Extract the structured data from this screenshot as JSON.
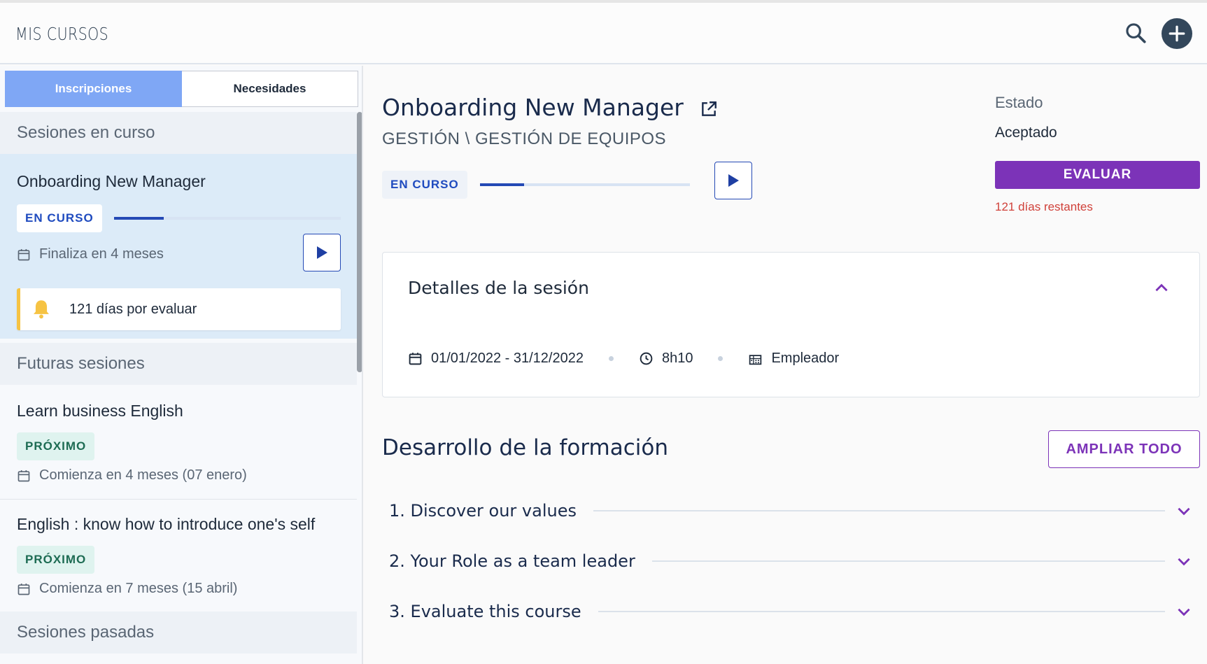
{
  "header": {
    "title": "MIS CURSOS"
  },
  "tabs": {
    "active": "Inscripciones",
    "inactive": "Necesidades"
  },
  "sections": {
    "current": "Sesiones en curso",
    "future": "Futuras sesiones",
    "past": "Sesiones pasadas"
  },
  "current_courses": [
    {
      "title": "Onboarding New Manager",
      "badge": "EN CURSO",
      "progress": 0.22,
      "meta": "Finaliza en 4 meses",
      "alert": "121 días por evaluar"
    }
  ],
  "future_courses": [
    {
      "title": "Learn business English",
      "badge": "PRÓXIMO",
      "meta": "Comienza en 4 meses (07 enero)"
    },
    {
      "title": "English : know how to introduce one's self",
      "badge": "PRÓXIMO",
      "meta": "Comienza en 7 meses (15 abril)"
    }
  ],
  "detail": {
    "title": "Onboarding New Manager",
    "breadcrumb": "GESTIÓN \\ GESTIÓN DE EQUIPOS",
    "badge": "EN CURSO",
    "progress": 0.21,
    "status_label": "Estado",
    "status_value": "Aceptado",
    "evaluate_label": "EVALUAR",
    "days_left": "121 días restantes"
  },
  "session_details": {
    "title": "Detalles de la sesión",
    "dates": "01/01/2022 - 31/12/2022",
    "duration": "8h10",
    "organizer": "Empleador"
  },
  "development": {
    "title": "Desarrollo de la formación",
    "expand_label": "AMPLIAR TODO",
    "modules": [
      "1. Discover our values",
      "2. Your Role as a team leader",
      "3. Evaluate this course"
    ]
  },
  "colors": {
    "primary_blue": "#2449b5",
    "tab_active": "#7fa7f5",
    "purple": "#7c33b8",
    "alert_red": "#d0413a",
    "bell": "#f6c343"
  },
  "icons": [
    "search-icon",
    "add-icon",
    "play-icon",
    "calendar-icon",
    "bell-icon",
    "external-link-icon",
    "chevron-up-icon",
    "chevron-down-icon",
    "clock-icon",
    "building-icon"
  ]
}
